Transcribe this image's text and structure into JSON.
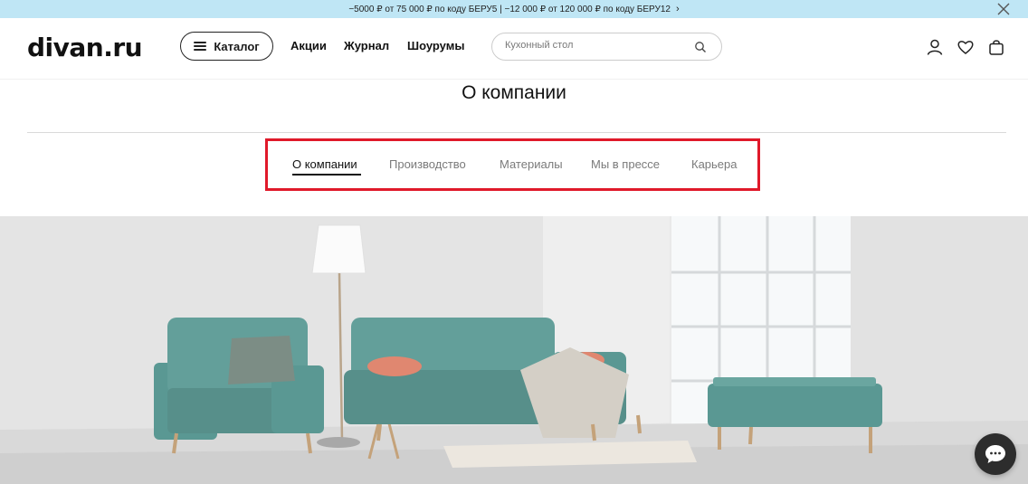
{
  "promo": {
    "text": "−5000 ₽ от 75 000 ₽ по коду БЕРУ5 | −12 000 ₽ от 120 000 ₽ по коду БЕРУ12",
    "chevron": "›",
    "close_icon": "close-icon"
  },
  "header": {
    "logo": "divan.ru",
    "catalog_label": "Каталог",
    "nav": [
      "Акции",
      "Журнал",
      "Шоурумы"
    ],
    "search": {
      "placeholder": "Кухонный стол",
      "value": ""
    },
    "icons": [
      "user-icon",
      "heart-icon",
      "cart-icon"
    ]
  },
  "page": {
    "title": "О компании"
  },
  "tabs": [
    {
      "label": "О компании",
      "active": true
    },
    {
      "label": "Производство",
      "active": false
    },
    {
      "label": "Материалы",
      "active": false
    },
    {
      "label": "Мы в прессе",
      "active": false
    },
    {
      "label": "Карьера",
      "active": false
    }
  ],
  "colors": {
    "promo_bg": "#bfe6f5",
    "highlight_border": "#e0192a",
    "sofa": "#5f9f99",
    "chat_bg": "#2d2d2d"
  },
  "hero": {
    "icon": "hero-image"
  },
  "chat": {
    "icon": "chat-icon"
  }
}
